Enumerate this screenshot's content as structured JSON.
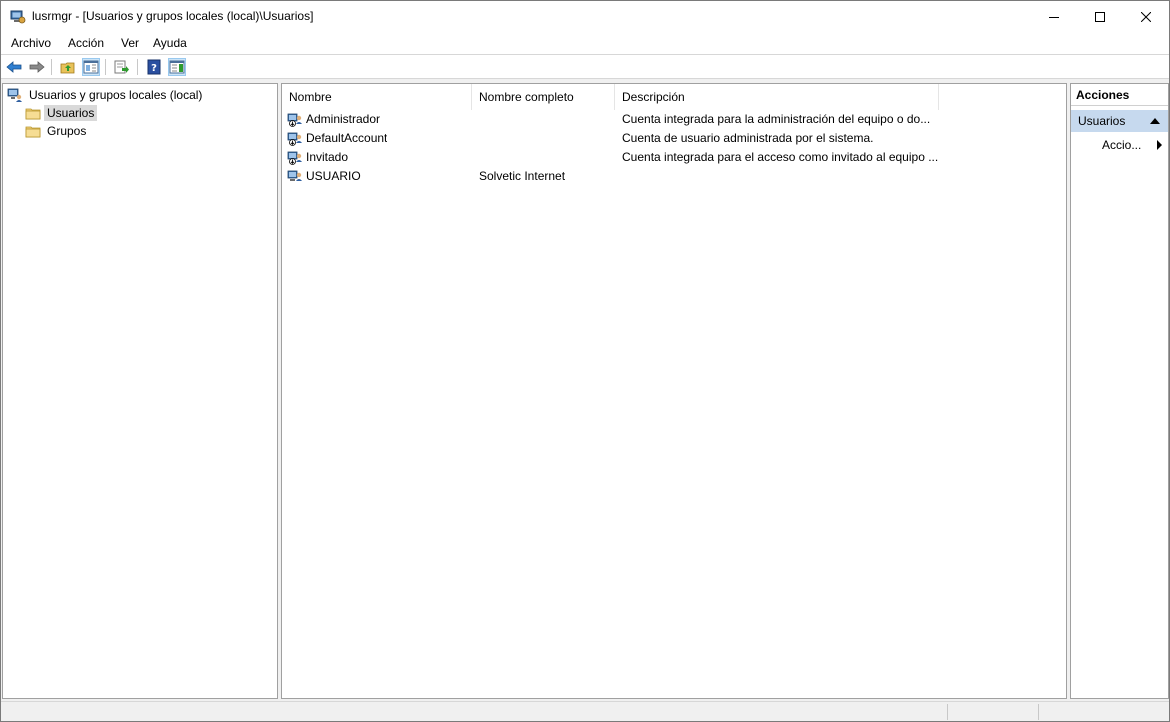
{
  "window": {
    "title": "lusrmgr - [Usuarios y grupos locales (local)\\Usuarios]"
  },
  "menu": {
    "items": [
      "Archivo",
      "Acción",
      "Ver",
      "Ayuda"
    ]
  },
  "toolbar": {
    "buttons": [
      "back-arrow-icon",
      "forward-arrow-icon",
      "up-folder-icon",
      "show-hide-tree-icon",
      "export-list-icon",
      "help-icon",
      "show-hide-action-pane-icon"
    ]
  },
  "tree": {
    "root_label": "Usuarios y grupos locales (local)",
    "children": [
      {
        "label": "Usuarios",
        "selected": true
      },
      {
        "label": "Grupos",
        "selected": false
      }
    ]
  },
  "list": {
    "columns": [
      "Nombre",
      "Nombre completo",
      "Descripción"
    ],
    "rows": [
      {
        "name": "Administrador",
        "full_name": "",
        "description": "Cuenta integrada para la administración del equipo o do..."
      },
      {
        "name": "DefaultAccount",
        "full_name": "",
        "description": "Cuenta de usuario administrada por el sistema."
      },
      {
        "name": "Invitado",
        "full_name": "",
        "description": "Cuenta integrada para el acceso como invitado al equipo ..."
      },
      {
        "name": "USUARIO",
        "full_name": "Solvetic Internet",
        "description": ""
      }
    ]
  },
  "actions": {
    "title": "Acciones",
    "section": "Usuarios",
    "item": "Accio..."
  },
  "colors": {
    "selection_gray": "#d9d9d9",
    "action_section_blue": "#c6d9ee",
    "toolbar_active": "#cce4f7"
  }
}
